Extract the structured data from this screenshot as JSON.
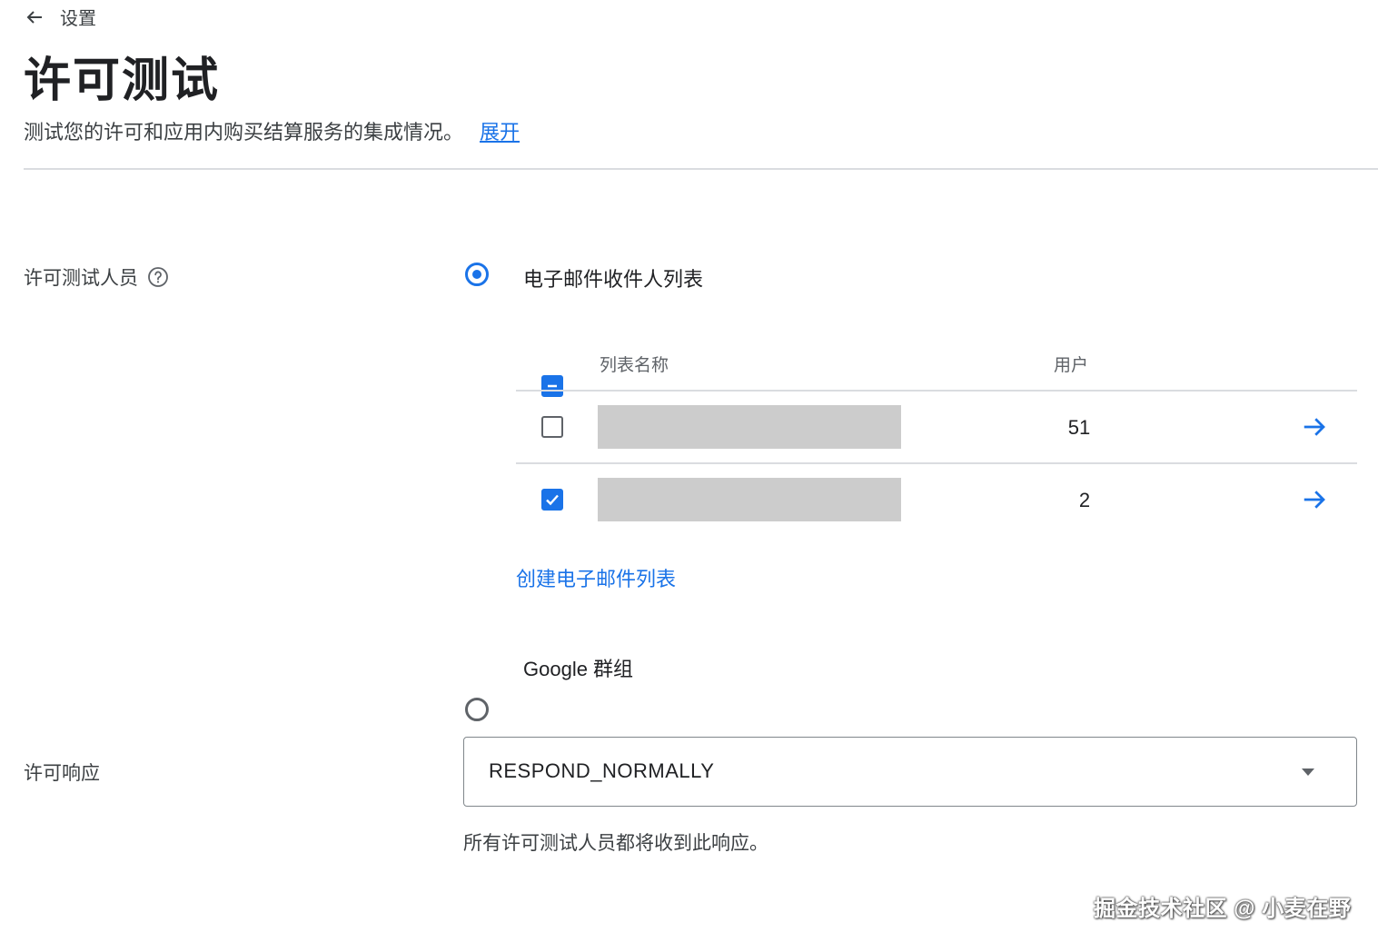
{
  "header": {
    "back_label": "设置",
    "title": "许可测试",
    "description": "测试您的许可和应用内购买结算服务的集成情况。",
    "expand_link": "展开"
  },
  "testers": {
    "label": "许可测试人员",
    "help_icon": "help-circle-icon",
    "option_email": "电子邮件收件人列表",
    "option_email_selected": true,
    "table": {
      "col_name": "列表名称",
      "col_users": "用户",
      "header_checkbox_state": "indeterminate",
      "rows": [
        {
          "checked": false,
          "users": "51",
          "name_redacted": true
        },
        {
          "checked": true,
          "users": "2",
          "name_redacted": true
        }
      ]
    },
    "create_link": "创建电子邮件列表",
    "option_group": "Google 群组",
    "option_group_selected": false
  },
  "response": {
    "label": "许可响应",
    "selected": "RESPOND_NORMALLY",
    "helper": "所有许可测试人员都将收到此响应。"
  },
  "watermark": "掘金技术社区 @ 小麦在野",
  "colors": {
    "accent": "#1a73e8",
    "text": "#202124",
    "secondary_text": "#3c4043",
    "divider": "#dadce0",
    "redaction": "#cccccc"
  }
}
